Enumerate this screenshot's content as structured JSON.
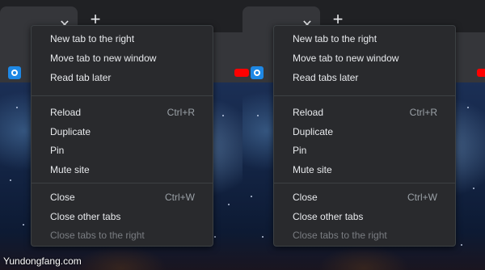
{
  "panes": [
    {
      "menu": {
        "items": [
          {
            "label": "New tab to the right",
            "accel": "",
            "disabled": false
          },
          {
            "label": "Move tab to new window",
            "accel": "",
            "disabled": false
          },
          {
            "label": "Read tab later",
            "accel": "",
            "disabled": false
          },
          {
            "label": "Reload",
            "accel": "Ctrl+R",
            "disabled": false
          },
          {
            "label": "Duplicate",
            "accel": "",
            "disabled": false
          },
          {
            "label": "Pin",
            "accel": "",
            "disabled": false
          },
          {
            "label": "Mute site",
            "accel": "",
            "disabled": false
          },
          {
            "label": "Close",
            "accel": "Ctrl+W",
            "disabled": false
          },
          {
            "label": "Close other tabs",
            "accel": "",
            "disabled": false
          },
          {
            "label": "Close tabs to the right",
            "accel": "",
            "disabled": true
          }
        ]
      }
    },
    {
      "menu": {
        "items": [
          {
            "label": "New tab to the right",
            "accel": "",
            "disabled": false
          },
          {
            "label": "Move tab to new window",
            "accel": "",
            "disabled": false
          },
          {
            "label": "Read tabs later",
            "accel": "",
            "disabled": false
          },
          {
            "label": "Reload",
            "accel": "Ctrl+R",
            "disabled": false
          },
          {
            "label": "Duplicate",
            "accel": "",
            "disabled": false
          },
          {
            "label": "Pin",
            "accel": "",
            "disabled": false
          },
          {
            "label": "Mute site",
            "accel": "",
            "disabled": false
          },
          {
            "label": "Close",
            "accel": "Ctrl+W",
            "disabled": false
          },
          {
            "label": "Close other tabs",
            "accel": "",
            "disabled": false
          },
          {
            "label": "Close tabs to the right",
            "accel": "",
            "disabled": true
          }
        ]
      }
    }
  ],
  "tab": {
    "close_glyph": "✕",
    "new_tab_glyph": "+"
  },
  "icons": {
    "bookmark_1": "generic-blue-icon",
    "bookmark_2": "youtube-icon"
  },
  "colors": {
    "menu_bg": "#292a2d",
    "text": "#e8eaed",
    "disabled_text": "#7a7d82",
    "accel_text": "#9aa0a6"
  },
  "watermark": "Yundongfang.com"
}
